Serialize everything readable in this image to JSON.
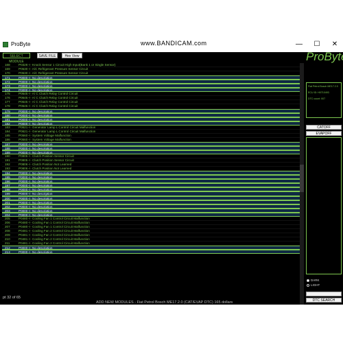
{
  "window": {
    "title": "ProByte",
    "watermark": "www.BANDICAM.com",
    "minimize": "—",
    "maximize": "☐",
    "close": "✕"
  },
  "toolbar": {
    "select_module": "SELECT MODULE",
    "save_file": "SAVE FILE",
    "hex_view": "Hex View"
  },
  "brand": "ProByte",
  "info": {
    "line1": "Fiat Petrol Bosch ME17.2.0",
    "line2": "ECU ID: H0710493",
    "line3": "DTC count: 007"
  },
  "side_buttons": {
    "catoff": "CATOFF",
    "evapoff": "EVAPOFF"
  },
  "theme": {
    "dark": "DARK",
    "light": "LIGHT"
  },
  "dtc_search": "DTC SEARCH",
  "status": "pt 32 of 65",
  "footer": "ADD NEW MODULES - Fiat Petrol Bosch ME17.2.0 (CAT/EVAP DTC) 165 dollars",
  "rows": [
    {
      "num": "168",
      "text": "P0328 <- Knock Sensor 1 Circuit High Input(Bank 1 or Single Sensor)"
    },
    {
      "num": "169",
      "text": "P0530 <- A/C Refrigerant Pressure Sensor Circuit"
    },
    {
      "num": "170",
      "text": "P0530 <- A/C Refrigerant Pressure Sensor Circuit"
    },
    {
      "num": "171",
      "text": "P0000 <- No description"
    },
    {
      "num": "172",
      "text": "P0000 <- No description"
    },
    {
      "num": "173",
      "text": "P0000 <- No description"
    },
    {
      "num": "174",
      "text": "P0000 <- No description"
    },
    {
      "num": "175",
      "text": "P0645 <- A/ C Clutch Relay Control Circuit"
    },
    {
      "num": "176",
      "text": "P0645 <- A/ C Clutch Relay Control Circuit"
    },
    {
      "num": "177",
      "text": "P0645 <- A/ C Clutch Relay Control Circuit"
    },
    {
      "num": "178",
      "text": "P0645 <- A/ C Clutch Relay Control Circuit"
    },
    {
      "num": "179",
      "text": "P0000 <- No description"
    },
    {
      "num": "180",
      "text": "P0000 <- No description"
    },
    {
      "num": "181",
      "text": "P0000 <- No description"
    },
    {
      "num": "182",
      "text": "P0000 <- No description"
    },
    {
      "num": "183",
      "text": "P0621 <- Generator Lamp L Control Circuit Malfunction"
    },
    {
      "num": "184",
      "text": "P0621 <- Generator Lamp L Control Circuit Malfunction"
    },
    {
      "num": "185",
      "text": "P0560 <- System Voltage Malfunction"
    },
    {
      "num": "186",
      "text": "P0560 <- System Voltage Malfunction"
    },
    {
      "num": "187",
      "text": "P0000 <- No description"
    },
    {
      "num": "188",
      "text": "P0000 <- No description"
    },
    {
      "num": "189",
      "text": "P0000 <- No description"
    },
    {
      "num": "190",
      "text": "P0805 <- Clutch Position Sensor Circuit"
    },
    {
      "num": "191",
      "text": "P0805 <- Clutch Position Sensor Circuit"
    },
    {
      "num": "192",
      "text": "P0806 <- Clutch Position Not Learned"
    },
    {
      "num": "193",
      "text": "P0806 <- Clutch Position Not Learned"
    },
    {
      "num": "194",
      "text": "P0000 <- No description"
    },
    {
      "num": "195",
      "text": "P0000 <- No description"
    },
    {
      "num": "196",
      "text": "P0000 <- No description"
    },
    {
      "num": "197",
      "text": "P0000 <- No description"
    },
    {
      "num": "198",
      "text": "P0000 <- No description"
    },
    {
      "num": "199",
      "text": "P0000 <- No description"
    },
    {
      "num": "200",
      "text": "P0000 <- No description"
    },
    {
      "num": "201",
      "text": "P0000 <- No description"
    },
    {
      "num": "202",
      "text": "P0000 <- No description"
    },
    {
      "num": "203",
      "text": "P0000 <- No description"
    },
    {
      "num": "204",
      "text": "P0000 <- No description"
    },
    {
      "num": "205",
      "text": "P0480 <- Cooling Fan 1 Control Circuit Malfunction"
    },
    {
      "num": "206",
      "text": "P0480 <- Cooling Fan 1 Control Circuit Malfunction"
    },
    {
      "num": "207",
      "text": "P0480 <- Cooling Fan 1 Control Circuit Malfunction"
    },
    {
      "num": "208",
      "text": "P0481 <- Cooling Fan 2 Control Circuit Malfunction"
    },
    {
      "num": "209",
      "text": "P0481 <- Cooling Fan 2 Control Circuit Malfunction"
    },
    {
      "num": "210",
      "text": "P0481 <- Cooling Fan 2 Control Circuit Malfunction"
    },
    {
      "num": "211",
      "text": "P0481 <- Cooling Fan 2 Control Circuit Malfunction"
    },
    {
      "num": "212",
      "text": "P0000 <- No description"
    },
    {
      "num": "213",
      "text": "P0000 <- No description"
    }
  ],
  "colors": {
    "text_green": "#7ec850",
    "highlight_bg": "#0f2a44",
    "background": "#000000"
  }
}
